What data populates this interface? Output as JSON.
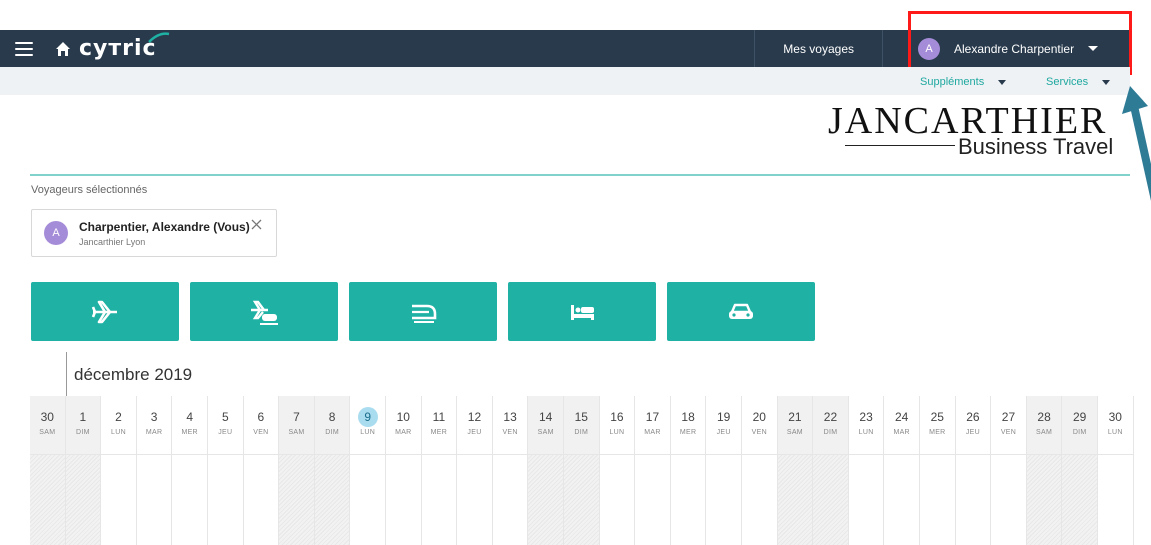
{
  "header": {
    "logo_text": "cyтric",
    "trips_link": "Mes voyages",
    "user_initial": "A",
    "user_name": "Alexandre Charpentier"
  },
  "subnav": {
    "supplements": "Suppléments",
    "services": "Services"
  },
  "brand": {
    "name": "JANCARTHIER",
    "tagline": "Business Travel"
  },
  "travelers": {
    "label": "Voyageurs sélectionnés",
    "items": [
      {
        "initial": "A",
        "name": "Charpentier, Alexandre (Vous)",
        "company": "Jancarthier Lyon"
      }
    ]
  },
  "services": [
    {
      "icon": "airplane-icon"
    },
    {
      "icon": "flight-train-icon"
    },
    {
      "icon": "train-icon"
    },
    {
      "icon": "hotel-icon"
    },
    {
      "icon": "car-icon"
    }
  ],
  "calendar": {
    "month": "décembre 2019",
    "days": [
      {
        "n": "30",
        "d": "SAM",
        "we": true
      },
      {
        "n": "1",
        "d": "DIM",
        "we": true
      },
      {
        "n": "2",
        "d": "LUN"
      },
      {
        "n": "3",
        "d": "MAR"
      },
      {
        "n": "4",
        "d": "MER"
      },
      {
        "n": "5",
        "d": "JEU"
      },
      {
        "n": "6",
        "d": "VEN"
      },
      {
        "n": "7",
        "d": "SAM",
        "we": true
      },
      {
        "n": "8",
        "d": "DIM",
        "we": true
      },
      {
        "n": "9",
        "d": "LUN",
        "today": true
      },
      {
        "n": "10",
        "d": "MAR"
      },
      {
        "n": "11",
        "d": "MER"
      },
      {
        "n": "12",
        "d": "JEU"
      },
      {
        "n": "13",
        "d": "VEN"
      },
      {
        "n": "14",
        "d": "SAM",
        "we": true
      },
      {
        "n": "15",
        "d": "DIM",
        "we": true
      },
      {
        "n": "16",
        "d": "LUN"
      },
      {
        "n": "17",
        "d": "MAR"
      },
      {
        "n": "18",
        "d": "MER"
      },
      {
        "n": "19",
        "d": "JEU"
      },
      {
        "n": "20",
        "d": "VEN"
      },
      {
        "n": "21",
        "d": "SAM",
        "we": true
      },
      {
        "n": "22",
        "d": "DIM",
        "we": true
      },
      {
        "n": "23",
        "d": "LUN"
      },
      {
        "n": "24",
        "d": "MAR"
      },
      {
        "n": "25",
        "d": "MER"
      },
      {
        "n": "26",
        "d": "JEU"
      },
      {
        "n": "27",
        "d": "VEN"
      },
      {
        "n": "28",
        "d": "SAM",
        "we": true
      },
      {
        "n": "29",
        "d": "DIM",
        "we": true
      },
      {
        "n": "30",
        "d": "LUN"
      }
    ]
  },
  "colors": {
    "topbar": "#283a4c",
    "accent": "#1fb1a4",
    "highlight": "#ff1a1a",
    "avatar": "#a58cd8"
  }
}
